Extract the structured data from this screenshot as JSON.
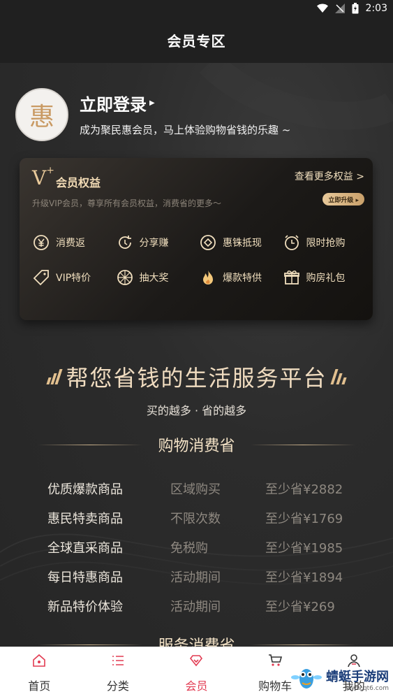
{
  "status_bar": {
    "time": "2:03"
  },
  "header": {
    "title": "会员专区"
  },
  "login": {
    "avatar_text": "惠",
    "title": "立即登录",
    "subtitle": "成为聚民惠会员，马上体验购物省钱的乐趣 ~"
  },
  "benefits_card": {
    "badge": "V",
    "badge_sup": "+",
    "title": "会员权益",
    "more_link": "查看更多权益 >",
    "description": "升级VIP会员，尊享所有会员权益，消费省的更多～",
    "upgrade_button": "立即升级 ▸",
    "items": [
      {
        "label": "消费返",
        "icon": "yen-circle-icon"
      },
      {
        "label": "分享赚",
        "icon": "share-refresh-icon"
      },
      {
        "label": "惠铢抵现",
        "icon": "coin-diamond-icon"
      },
      {
        "label": "限时抢购",
        "icon": "alarm-clock-icon"
      },
      {
        "label": "VIP特价",
        "icon": "price-tag-icon"
      },
      {
        "label": "抽大奖",
        "icon": "prize-wheel-icon"
      },
      {
        "label": "爆款特供",
        "icon": "flame-icon"
      },
      {
        "label": "购房礼包",
        "icon": "gift-icon"
      }
    ]
  },
  "slogan": {
    "title": "帮您省钱的生活服务平台",
    "subtitle": "买的越多 · 省的越多"
  },
  "sections": [
    {
      "title": "购物消费省",
      "rows": [
        {
          "name": "优质爆款商品",
          "condition": "区域购买",
          "saving": "至少省¥2882"
        },
        {
          "name": "惠民特卖商品",
          "condition": "不限次数",
          "saving": "至少省¥1769"
        },
        {
          "name": "全球直采商品",
          "condition": "免税购",
          "saving": "至少省¥1985"
        },
        {
          "name": "每日特惠商品",
          "condition": "活动期间",
          "saving": "至少省¥1894"
        },
        {
          "name": "新品特价体验",
          "condition": "活动期间",
          "saving": "至少省¥269"
        }
      ]
    },
    {
      "title": "服务消费省"
    }
  ],
  "bottom_nav": [
    {
      "label": "首页",
      "icon": "home-icon",
      "active": false
    },
    {
      "label": "分类",
      "icon": "list-icon",
      "active": false
    },
    {
      "label": "会员",
      "icon": "diamond-heart-icon",
      "active": true
    },
    {
      "label": "购物车",
      "icon": "cart-icon",
      "active": false
    },
    {
      "label": "我的",
      "icon": "user-icon",
      "active": false
    }
  ],
  "watermark": {
    "text": "蜻蜓手游网",
    "sub": "www.qt6.com"
  },
  "colors": {
    "accent": "#e23b52",
    "gold": "#f1dfbe",
    "bg": "#2b2b2b"
  }
}
